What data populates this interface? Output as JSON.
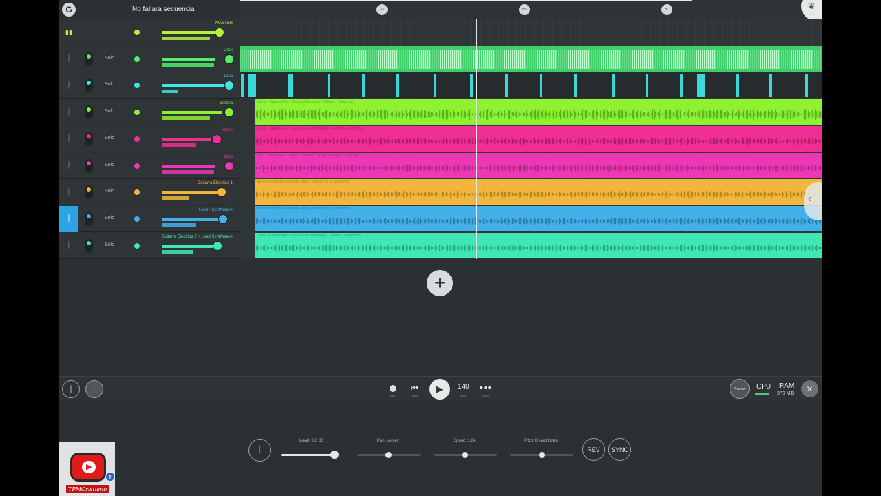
{
  "header": {
    "project_title": "No fallara secuencia"
  },
  "ruler": {
    "markers": [
      "33",
      "65",
      "97"
    ]
  },
  "tracks": [
    {
      "name": "MASTER",
      "color": "#b6f23a",
      "solo": "",
      "icon": "mixer-bars-icon"
    },
    {
      "name": "Click",
      "color": "#4ef06e",
      "solo": "Solo",
      "icon": "waveform-icon"
    },
    {
      "name": "Guia",
      "color": "#3ee6e6",
      "solo": "Solo",
      "icon": "waveform-icon"
    },
    {
      "name": "Bateria",
      "color": "#8ef233",
      "solo": "Solo",
      "icon": "waveform-icon"
    },
    {
      "name": "Voces",
      "color": "#ef2f93",
      "solo": "Solo",
      "icon": "waveform-icon"
    },
    {
      "name": "Bajo",
      "color": "#ec38b5",
      "solo": "Solo",
      "icon": "waveform-icon"
    },
    {
      "name": "Guitarra Electrica 1",
      "color": "#f2b63c",
      "solo": "Solo",
      "icon": "waveform-icon"
    },
    {
      "name": "Lead - SynthWave",
      "color": "#43b0ea",
      "solo": "Solo",
      "icon": "waveform-icon"
    },
    {
      "name": "Guitarra Electrica 2 + Lead SynthWave",
      "color": "#3fe8b2",
      "solo": "Solo",
      "icon": "waveform-icon"
    }
  ],
  "clips": [
    {
      "label": "Drums - Wesley Ruiz - Nunca Falla.mpeg - 140bpm - Gmaj.mp3",
      "color": "#8ef233",
      "wave": "#5eb21c"
    },
    {
      "label": "Vocals - Wesley Ruiz - Nunca Falla.mp3.mpeg - 140bpm - Gmaj.mp3",
      "color": "#ef2f93",
      "wave": "#b01e68"
    },
    {
      "label": "Bass - Wesley Ruiz - Nunca Falla.mp3.mpeg - 140bpm - Gmaj.mp3",
      "color": "#ec38b5",
      "wave": "#b02787"
    },
    {
      "label": "wesley-ruiz-nunca-falla-mp3-mpeg_6stems_mt_0_guitar.mp3",
      "color": "#f2b63c",
      "wave": "#b78525"
    },
    {
      "label": "wesley-ruiz-nunca-falla-mp3-mpeg_6stems_mt_0_other.mp3",
      "color": "#43b0ea",
      "wave": "#2a7fae"
    },
    {
      "label": "Other - Wesley Ruiz - Nunca Falla.mp3.mpeg - 140bpm - Gmaj.mp3",
      "color": "#3fe8b2",
      "wave": "#27a880"
    }
  ],
  "transport": {
    "rec_label": "REC",
    "rew_label": "REV",
    "tempo": "140",
    "tempo_label": "BPM",
    "more_label": "OTRS",
    "preview_label": "Preview",
    "cpu_label": "CPU",
    "ram_label": "RAM",
    "ram_value": "379 MB"
  },
  "bottom": {
    "level_label": "Level: 0.0 dB",
    "pan_label": "Pan: center",
    "speed_label": "Speed: 1.0x",
    "pitch_label": "Pitch: 0 semitones",
    "rev_label": "REV",
    "sync_label": "SYNC"
  },
  "channel": {
    "name": "TPMCristiano"
  },
  "colors": {
    "accent": "#2aa4e6",
    "background": "#2b3033"
  }
}
